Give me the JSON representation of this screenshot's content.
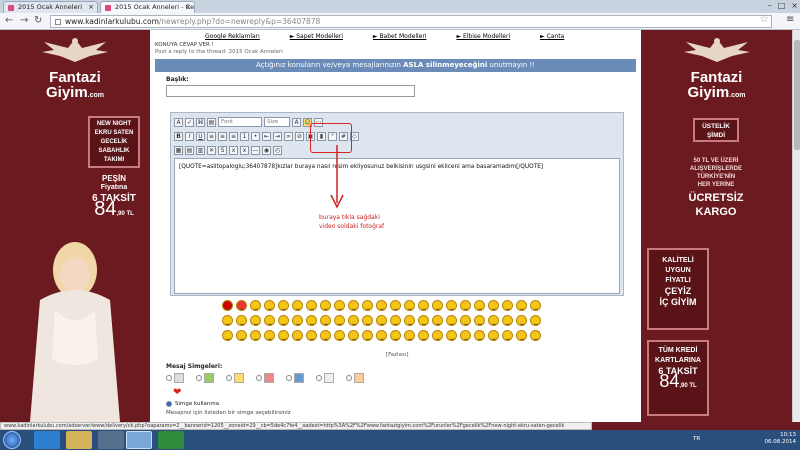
{
  "browser": {
    "tabs": [
      {
        "label": "2015 Ocak Anneleri"
      },
      {
        "label": "2015 Ocak Anneleri - Cev"
      }
    ],
    "url_host": "www.kadinlarkulubu.com",
    "url_path": "/newreply.php?do=newreply&p=36407878",
    "status_url": "www.kadinlarkulubu.com/adserver/www/delivery/ck.php?oaparams=2__bannerid=1205__zoneid=29__cb=5de4c7fe4__oadest=http%3A%2F%2Fwww.fantazigiyim.com%2Furunler%2Fgecelik%2Fnew-night-ekru-saten-gecelik"
  },
  "left_ad": {
    "brand": "Fantazi",
    "brand2": "Giyim",
    "brand_suffix": ".com",
    "product": [
      "NEW NIGHT",
      "EKRU SATEN",
      "GECELİK",
      "SABAHLIK",
      "TAKIMI"
    ],
    "price_label1": "PEŞİN",
    "price_label2": "Fiyatına",
    "installments": "6 TAKSİT",
    "price_int": "84",
    "price_dec": ",90 TL"
  },
  "right_ad": {
    "brand": "Fantazi",
    "brand2": "Giyim",
    "brand_suffix": ".com",
    "box1": [
      "ÜSTELİK",
      "ŞİMDİ"
    ],
    "line1": [
      "50 TL VE ÜZERİ",
      "ALIŞVERİŞLERDE",
      "TÜRKİYE'NİN",
      "HER YERİNE"
    ],
    "shipping": [
      "ÜCRETSİZ",
      "KARGO"
    ],
    "quality": [
      "KALİTELİ",
      "UYGUN",
      "FİYATLI",
      "ÇEYİZ",
      "İÇ GİYİM"
    ],
    "credit": [
      "TÜM KREDİ",
      "KARTLARINA",
      "6 TAKSİT"
    ],
    "price_int": "84",
    "price_dec": ",90 TL"
  },
  "nav": {
    "links": [
      "Google Reklamları",
      "► Sapet Modelleri",
      "► Babet Modelleri",
      "► Elbise Modelleri",
      "► Çanta"
    ]
  },
  "breadcrumb": {
    "title": "KONUYA CEVAP VER !",
    "subtitle": "Post a reply to the thread: 2015 Ocak Anneleri"
  },
  "notice": {
    "before": "Açtığınız konuların ve/veya mesajlarınızın ",
    "bold": "ASLA silinmeyeceğini",
    "after": " unutmayın !!"
  },
  "form": {
    "title_label": "Başlık:",
    "title_value": "",
    "font_select": "Font",
    "size_select": "Size",
    "editor_text": "[QUOTE=aslitopaloglu;36407878]kızlar buraya nasıl resim ekliyosunuz belkisinin usgsini ekliceni ama basaramadım[/QUOTE]",
    "annotation_line1": "buraya tıkla sağdaki",
    "annotation_line2": "video soldaki fotoğraf",
    "more_smilies": "[Fazlası]",
    "message_icons_label": "Mesaj Simgeleri:",
    "no_icon_label": "Simge kullanma",
    "hint": "Mesajınız için listeden bir simge seçebilirsiniz"
  },
  "taskbar": {
    "lang": "TR",
    "time": "10:13",
    "date": "06.08.2014"
  },
  "colors": {
    "ad_bg": "#6b1a1f",
    "notice_bg": "#6b8cb8",
    "annotation": "#cc2222"
  }
}
